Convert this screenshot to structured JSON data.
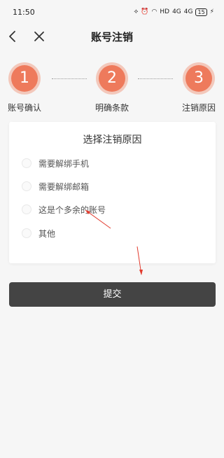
{
  "status_bar": {
    "time": "11:50",
    "network": "HD",
    "signal_1": "4G",
    "signal_2": "4G",
    "battery": "15"
  },
  "nav": {
    "title": "账号注销",
    "back_icon": "chevron-left-icon",
    "close_icon": "close-icon"
  },
  "steps": [
    {
      "number": "1",
      "label": "账号确认"
    },
    {
      "number": "2",
      "label": "明确条款"
    },
    {
      "number": "3",
      "label": "注销原因"
    }
  ],
  "reasons": {
    "title": "选择注销原因",
    "options": [
      "需要解绑手机",
      "需要解绑邮箱",
      "这是个多余的账号",
      "其他"
    ]
  },
  "submit_label": "提交",
  "colors": {
    "step_accent": "#ee7a5c",
    "button_bg": "#444444",
    "annotation_arrow": "#e23b2e"
  }
}
